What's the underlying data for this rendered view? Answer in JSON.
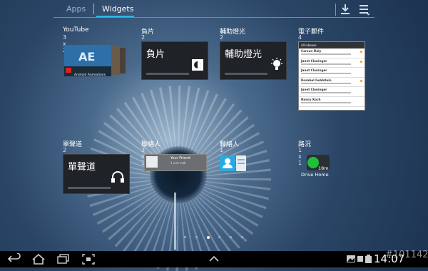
{
  "tabs": {
    "apps": "Apps",
    "widgets": "Widgets"
  },
  "widgets": {
    "youtube": {
      "title": "YouTube",
      "size": "3 x 2",
      "caption": "Android Animations"
    },
    "negative": {
      "title": "負片",
      "size": "2 x 2",
      "label": "負片"
    },
    "assist_light": {
      "title": "輔助燈光",
      "size": "2 x 2",
      "label": "輔助燈光"
    },
    "email": {
      "title": "電子郵件",
      "size": "4 x 5",
      "header": "All inboxes",
      "senders": [
        "Carson Daly",
        "Janet Cloninger",
        "Janet Cloninger",
        "Rosabel Goldstein",
        "Janet Cloninger",
        "Nancy Koch"
      ]
    },
    "single_track": {
      "title": "單聲道",
      "size": "2 x 2",
      "label": "單聲道"
    },
    "contacts_wide": {
      "title": "聯絡人",
      "size": "3 x 1",
      "name": "Your Friend",
      "sub": "1 unit mob"
    },
    "contacts_small": {
      "title": "聯絡人",
      "size": "1 x 1"
    },
    "traffic": {
      "title": "路況",
      "size": "1 x 1",
      "badge": "18m",
      "label": "Drive Home"
    }
  },
  "page_dots": {
    "count": 6,
    "active": 3
  },
  "status": {
    "time": "14:07",
    "watermark": "#101142"
  },
  "icons": {
    "download": "download-icon",
    "menu": "menu-icon",
    "back": "back-icon",
    "home": "home-icon",
    "recent": "recent-apps-icon",
    "screenshot": "screenshot-icon",
    "up": "chevron-up-icon"
  },
  "colors": {
    "accent": "#33b5e5",
    "traffic_green": "#1fbf3a"
  }
}
